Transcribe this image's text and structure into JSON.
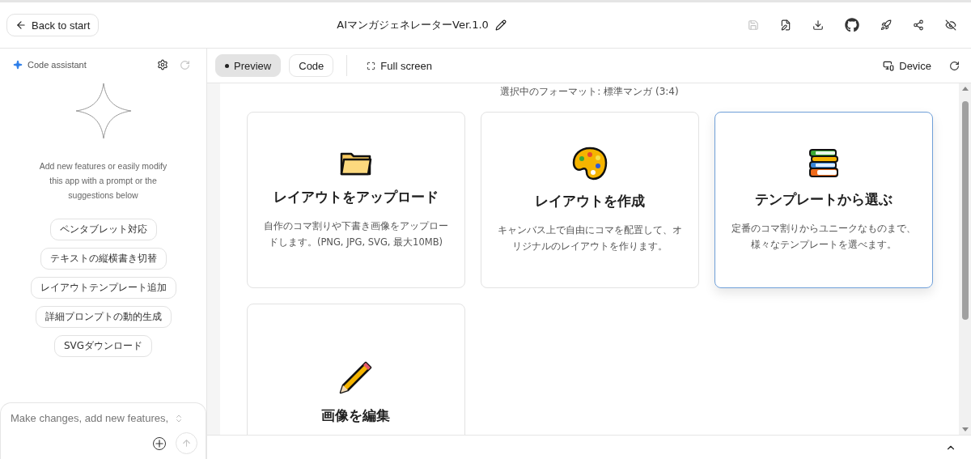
{
  "header": {
    "back_label": "Back to start",
    "title": "AIマンガジェネレーターVer.1.0",
    "actions": [
      {
        "kind": "save",
        "disabled": true
      },
      {
        "kind": "save-edit",
        "disabled": false
      },
      {
        "kind": "download",
        "disabled": false
      },
      {
        "kind": "github",
        "disabled": false
      },
      {
        "kind": "rocket",
        "disabled": false
      },
      {
        "kind": "share",
        "disabled": false
      },
      {
        "kind": "hide",
        "disabled": false
      }
    ]
  },
  "assistant": {
    "title": "Code assistant",
    "intro": "Add new features or easily modify this app with a prompt or the suggestions below",
    "suggestions": [
      "ペンタブレット対応",
      "テキストの縦横書き切替",
      "レイアウトテンプレート追加",
      "詳細プロンプトの動的生成",
      "SVGダウンロード"
    ],
    "input": {
      "placeholder": "Make changes, add new features,"
    }
  },
  "preview": {
    "tabs": [
      {
        "label": "Preview",
        "selected": true
      },
      {
        "label": "Code",
        "selected": false
      }
    ],
    "fullscreen_label": "Full screen",
    "device_label": "Device",
    "format_text": "選択中のフォーマット: 標準マンガ (3:4)",
    "cards": [
      {
        "kind": "folder",
        "title": "レイアウトをアップロード",
        "description": "自作のコマ割りや下書き画像をアップロードします。(PNG, JPG, SVG, 最大10MB)",
        "selected": false
      },
      {
        "kind": "palette",
        "title": "レイアウトを作成",
        "description": "キャンバス上で自由にコマを配置して、オリジナルのレイアウトを作ります。",
        "selected": false
      },
      {
        "kind": "books",
        "title": "テンプレートから選ぶ",
        "description": "定番のコマ割りからユニークなものまで、様々なテンプレートを選べます。",
        "selected": true
      },
      {
        "kind": "pencil",
        "title": "画像を編集",
        "selected": false
      }
    ]
  }
}
